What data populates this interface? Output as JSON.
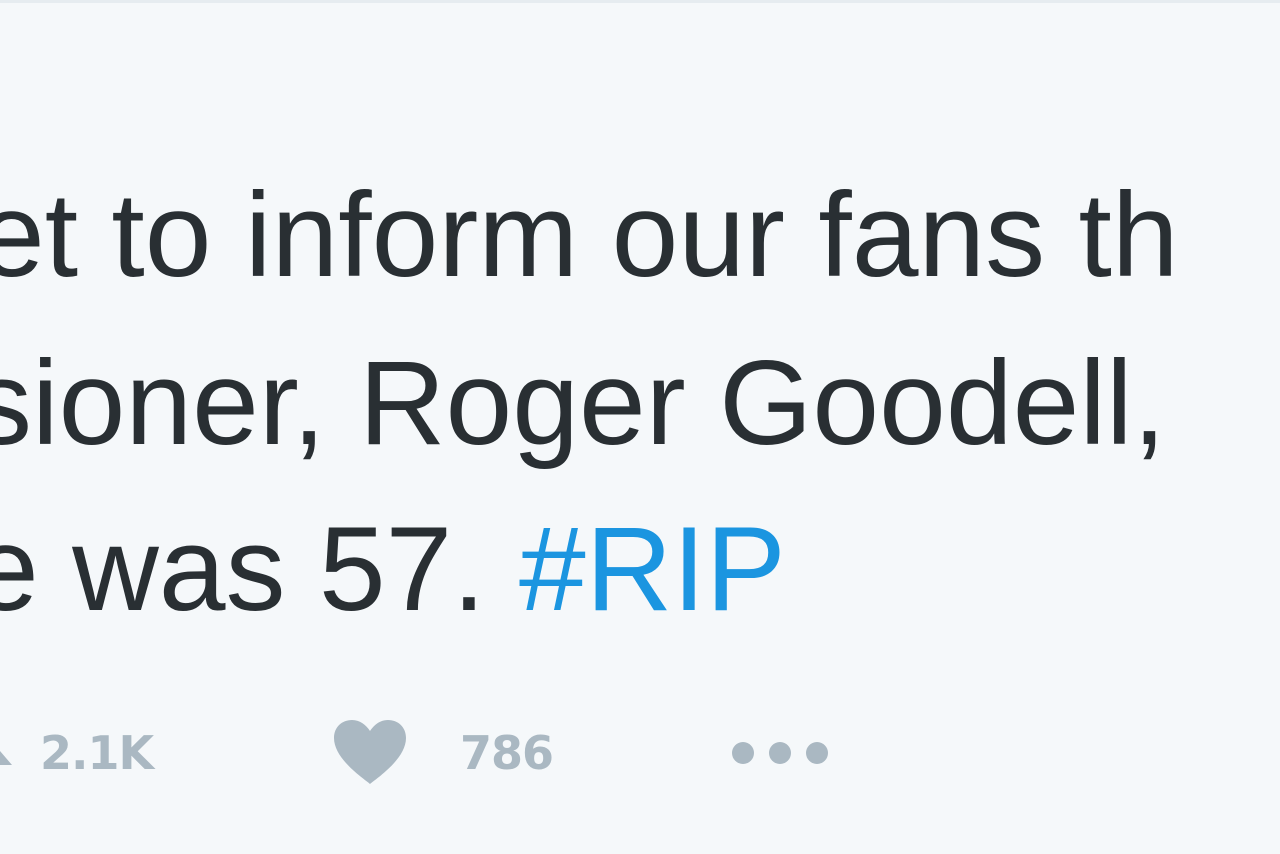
{
  "tweet": {
    "text_lines": [
      "et to inform our fans th",
      "sioner, Roger Goodell,",
      "e was 57. "
    ],
    "hashtag": "#RIP"
  },
  "actions": {
    "retweet": {
      "icon": "retweet-icon",
      "count": "2.1K"
    },
    "like": {
      "icon": "heart-icon",
      "count": "786"
    },
    "more": {
      "icon": "more-dots-icon"
    }
  },
  "colors": {
    "background": "#f5f8fa",
    "text": "#292f33",
    "hashtag": "#1b95e0",
    "action_gray": "#aab8c2"
  }
}
